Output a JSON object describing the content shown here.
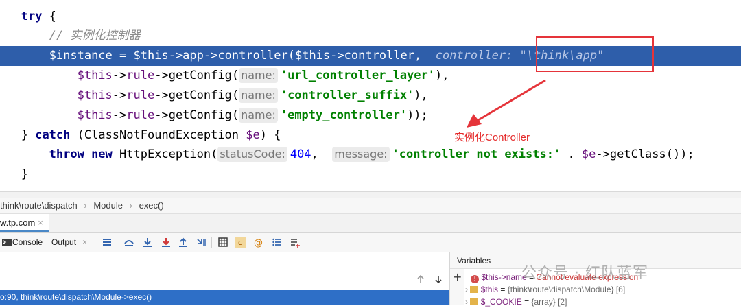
{
  "code_lines": [
    {
      "indent": "   ",
      "tokens": [
        {
          "c": "kw",
          "t": "try"
        },
        {
          "c": "fn",
          "t": " {"
        }
      ]
    },
    {
      "indent": "       ",
      "tokens": [
        {
          "c": "cmt",
          "t": "// 实例化控制器"
        }
      ]
    },
    {
      "indent": "       ",
      "highlight": true,
      "tokens": [
        {
          "c": "var",
          "t": "$instance"
        },
        {
          "c": "fn",
          "t": " = "
        },
        {
          "c": "var",
          "t": "$this"
        },
        {
          "c": "fn",
          "t": "->"
        },
        {
          "c": "var",
          "t": "app"
        },
        {
          "c": "fn",
          "t": "->"
        },
        {
          "c": "fn",
          "t": "controller("
        },
        {
          "c": "var",
          "t": "$this"
        },
        {
          "c": "fn",
          "t": "->"
        },
        {
          "c": "var",
          "t": "controller"
        },
        {
          "c": "fn",
          "t": ",  "
        },
        {
          "c": "dbg",
          "t": "controller: \"\\think\\app\""
        }
      ]
    },
    {
      "indent": "           ",
      "tokens": [
        {
          "c": "var",
          "t": "$this"
        },
        {
          "c": "fn",
          "t": "->"
        },
        {
          "c": "var",
          "t": "rule"
        },
        {
          "c": "fn",
          "t": "->"
        },
        {
          "c": "fn",
          "t": "getConfig("
        },
        {
          "c": "hint",
          "t": "name:"
        },
        {
          "c": "str",
          "t": "'url_controller_layer'"
        },
        {
          "c": "fn",
          "t": "),"
        }
      ]
    },
    {
      "indent": "           ",
      "tokens": [
        {
          "c": "var",
          "t": "$this"
        },
        {
          "c": "fn",
          "t": "->"
        },
        {
          "c": "var",
          "t": "rule"
        },
        {
          "c": "fn",
          "t": "->"
        },
        {
          "c": "fn",
          "t": "getConfig("
        },
        {
          "c": "hint",
          "t": "name:"
        },
        {
          "c": "str",
          "t": "'controller_suffix'"
        },
        {
          "c": "fn",
          "t": "),"
        }
      ]
    },
    {
      "indent": "           ",
      "tokens": [
        {
          "c": "var",
          "t": "$this"
        },
        {
          "c": "fn",
          "t": "->"
        },
        {
          "c": "var",
          "t": "rule"
        },
        {
          "c": "fn",
          "t": "->"
        },
        {
          "c": "fn",
          "t": "getConfig("
        },
        {
          "c": "hint",
          "t": "name:"
        },
        {
          "c": "str",
          "t": "'empty_controller'"
        },
        {
          "c": "fn",
          "t": "));"
        }
      ]
    },
    {
      "indent": "   ",
      "tokens": [
        {
          "c": "fn",
          "t": "} "
        },
        {
          "c": "kw",
          "t": "catch"
        },
        {
          "c": "fn",
          "t": " (ClassNotFoundException "
        },
        {
          "c": "var",
          "t": "$e"
        },
        {
          "c": "fn",
          "t": ") {"
        }
      ]
    },
    {
      "indent": "       ",
      "tokens": [
        {
          "c": "kw",
          "t": "throw new "
        },
        {
          "c": "fn",
          "t": "HttpException("
        },
        {
          "c": "hint",
          "t": "statusCode:"
        },
        {
          "c": "num",
          "t": "404"
        },
        {
          "c": "fn",
          "t": ",  "
        },
        {
          "c": "hint",
          "t": "message:"
        },
        {
          "c": "str",
          "t": "'controller not exists:'"
        },
        {
          "c": "fn",
          "t": " . "
        },
        {
          "c": "var",
          "t": "$e"
        },
        {
          "c": "fn",
          "t": "->getClass());"
        }
      ]
    },
    {
      "indent": "   ",
      "tokens": [
        {
          "c": "fn",
          "t": "}"
        }
      ]
    }
  ],
  "annotation": "实例化Controller",
  "breadcrumb": [
    "think\\route\\dispatch",
    "Module",
    "exec()"
  ],
  "debug_tab": "w.tp.com",
  "toolbar": {
    "console": "Console",
    "output": "Output"
  },
  "frame": "o:90, think\\route\\dispatch\\Module->exec()",
  "variables": {
    "title": "Variables",
    "rows": [
      {
        "name": "$this->name",
        "value": "Cannot evaluate expression",
        "error": true
      },
      {
        "name": "$this",
        "value": "{think\\route\\dispatch\\Module} [6]",
        "error": false
      },
      {
        "name": "$_COOKIE",
        "value": "{array} [2]",
        "error": false
      }
    ]
  },
  "watermark": "公众号 · 红队蓝军",
  "colors": {
    "highlight": "#2e5eaa",
    "annotation_red": "#e5343a",
    "selected_frame": "#2e6fc7"
  }
}
